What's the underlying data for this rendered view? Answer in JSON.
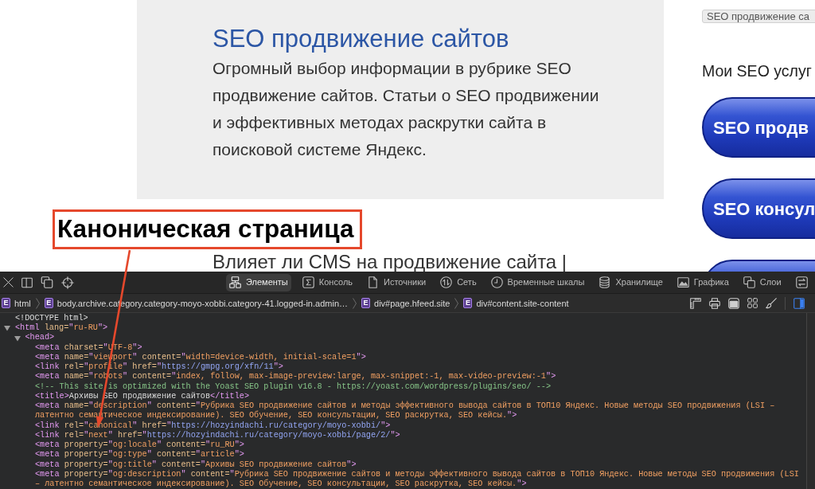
{
  "page": {
    "category": {
      "title": "SEO продвижение сайтов",
      "description_lines": [
        "Огромный выбор информации в рубрике SEO",
        "продвижение сайтов. Статьи о SEO продвижении",
        "и эффективных методах раскрутки сайта в",
        "поисковой системе Яндекс."
      ]
    },
    "annotation": {
      "label": "Каноническая страница"
    },
    "next_post_title": "Влияет ли CMS на продвижение сайта |",
    "sidebar": {
      "category_tag": "SEO продвижение са",
      "heading": "Мои SEO услуг",
      "service_buttons": [
        {
          "kind": "labeled",
          "label": "SEO продв"
        },
        {
          "kind": "labeled",
          "label": "SEO консул"
        },
        {
          "kind": "cut"
        }
      ]
    }
  },
  "devtools": {
    "tabs": [
      {
        "label": "Элементы",
        "selected": true
      },
      {
        "label": "Консоль",
        "selected": false
      },
      {
        "label": "Источники",
        "selected": false
      },
      {
        "label": "Сеть",
        "selected": false
      },
      {
        "label": "Временные шкалы",
        "selected": false
      },
      {
        "label": "Хранилище",
        "selected": false
      },
      {
        "label": "Графика",
        "selected": false
      },
      {
        "label": "Слои",
        "selected": false
      },
      {
        "selected": false
      }
    ],
    "sidebar_toggle": {
      "on": true
    },
    "breadcrumbs": [
      {
        "badge": "E",
        "label": "html"
      },
      {
        "badge": "E",
        "label": "body.archive.category.category-moyo-xobbi.category-41.logged-in.admin…"
      },
      {
        "badge": "E",
        "label": "div#page.hfeed.site"
      },
      {
        "badge": "E",
        "label": "div#content.site-content"
      }
    ],
    "dom_tree": [
      {
        "tokens": [
          {
            "kind": "text",
            "text": "<!DOCTYPE html>"
          }
        ]
      },
      {
        "expanded": true,
        "tokens": [
          {
            "kind": "tag",
            "text": "<html"
          },
          {
            "kind": "attr",
            "text": " lang="
          },
          {
            "kind": "value",
            "text": "\"ru-RU\""
          },
          {
            "kind": "tag",
            "text": ">"
          }
        ],
        "children": [
          {
            "expanded": true,
            "tokens": [
              {
                "kind": "tag",
                "text": "<head>"
              }
            ],
            "children": [
              {
                "tokens": [
                  {
                    "kind": "tag",
                    "text": "<meta"
                  },
                  {
                    "kind": "attr",
                    "text": " charset="
                  },
                  {
                    "kind": "value",
                    "text": "\"UTF-8\""
                  },
                  {
                    "kind": "tag",
                    "text": ">"
                  }
                ]
              },
              {
                "tokens": [
                  {
                    "kind": "tag",
                    "text": "<meta"
                  },
                  {
                    "kind": "attr",
                    "text": " name="
                  },
                  {
                    "kind": "value",
                    "text": "\"viewport\""
                  },
                  {
                    "kind": "attr",
                    "text": " content="
                  },
                  {
                    "kind": "value",
                    "text": "\"width=device-width, initial-scale=1\""
                  },
                  {
                    "kind": "tag",
                    "text": ">"
                  }
                ]
              },
              {
                "tokens": [
                  {
                    "kind": "tag",
                    "text": "<link"
                  },
                  {
                    "kind": "attr",
                    "text": " rel="
                  },
                  {
                    "kind": "value",
                    "text": "\"profile\""
                  },
                  {
                    "kind": "attr",
                    "text": " href="
                  },
                  {
                    "kind": "url",
                    "text": "\"https://gmpg.org/xfn/11\""
                  },
                  {
                    "kind": "tag",
                    "text": ">"
                  }
                ]
              },
              {
                "tokens": [
                  {
                    "kind": "tag",
                    "text": "<meta"
                  },
                  {
                    "kind": "attr",
                    "text": " name="
                  },
                  {
                    "kind": "value",
                    "text": "\"robots\""
                  },
                  {
                    "kind": "attr",
                    "text": " content="
                  },
                  {
                    "kind": "value",
                    "text": "\"index, follow, max-image-preview:large, max-snippet:-1, max-video-preview:-1\""
                  },
                  {
                    "kind": "tag",
                    "text": ">"
                  }
                ]
              },
              {
                "tokens": [
                  {
                    "kind": "comment",
                    "text": "<!-- This site is optimized with the Yoast SEO plugin v16.8 - https://yoast.com/wordpress/plugins/seo/ -->"
                  }
                ]
              },
              {
                "tokens": [
                  {
                    "kind": "tag",
                    "text": "<title>"
                  },
                  {
                    "kind": "text",
                    "text": "Архивы SEO продвижение сайтов"
                  },
                  {
                    "kind": "tag",
                    "text": "</title>"
                  }
                ]
              },
              {
                "tokens": [
                  {
                    "kind": "tag",
                    "text": "<meta"
                  },
                  {
                    "kind": "attr",
                    "text": " name="
                  },
                  {
                    "kind": "value",
                    "text": "\"description\""
                  },
                  {
                    "kind": "attr",
                    "text": " content="
                  },
                  {
                    "kind": "value",
                    "text": "\"Рубрика SEO продвижение сайтов и методы эффективного вывода сайтов в ТОП10 Яндекс. Новые методы SEO продвижения (LSI – латентно семантическое индексирование). SEO Обучение, SEO консультации, SEO раскрутка, SEO кейсы.\""
                  },
                  {
                    "kind": "tag",
                    "text": ">"
                  }
                ]
              },
              {
                "tokens": [
                  {
                    "kind": "tag",
                    "text": "<link"
                  },
                  {
                    "kind": "attr",
                    "text": " rel="
                  },
                  {
                    "kind": "value",
                    "text": "\"canonical\""
                  },
                  {
                    "kind": "attr",
                    "text": " href="
                  },
                  {
                    "kind": "url",
                    "text": "\"https://hozyindachi.ru/category/moyo-xobbi/\""
                  },
                  {
                    "kind": "tag",
                    "text": ">"
                  }
                ]
              },
              {
                "tokens": [
                  {
                    "kind": "tag",
                    "text": "<link"
                  },
                  {
                    "kind": "attr",
                    "text": " rel="
                  },
                  {
                    "kind": "value",
                    "text": "\"next\""
                  },
                  {
                    "kind": "attr",
                    "text": " href="
                  },
                  {
                    "kind": "url",
                    "text": "\"https://hozyindachi.ru/category/moyo-xobbi/page/2/\""
                  },
                  {
                    "kind": "tag",
                    "text": ">"
                  }
                ]
              },
              {
                "tokens": [
                  {
                    "kind": "tag",
                    "text": "<meta"
                  },
                  {
                    "kind": "attr",
                    "text": " property="
                  },
                  {
                    "kind": "value",
                    "text": "\"og:locale\""
                  },
                  {
                    "kind": "attr",
                    "text": " content="
                  },
                  {
                    "kind": "value",
                    "text": "\"ru_RU\""
                  },
                  {
                    "kind": "tag",
                    "text": ">"
                  }
                ]
              },
              {
                "tokens": [
                  {
                    "kind": "tag",
                    "text": "<meta"
                  },
                  {
                    "kind": "attr",
                    "text": " property="
                  },
                  {
                    "kind": "value",
                    "text": "\"og:type\""
                  },
                  {
                    "kind": "attr",
                    "text": " content="
                  },
                  {
                    "kind": "value",
                    "text": "\"article\""
                  },
                  {
                    "kind": "tag",
                    "text": ">"
                  }
                ]
              },
              {
                "tokens": [
                  {
                    "kind": "tag",
                    "text": "<meta"
                  },
                  {
                    "kind": "attr",
                    "text": " property="
                  },
                  {
                    "kind": "value",
                    "text": "\"og:title\""
                  },
                  {
                    "kind": "attr",
                    "text": " content="
                  },
                  {
                    "kind": "value",
                    "text": "\"Архивы SEO продвижение сайтов\""
                  },
                  {
                    "kind": "tag",
                    "text": ">"
                  }
                ]
              },
              {
                "tokens": [
                  {
                    "kind": "tag",
                    "text": "<meta"
                  },
                  {
                    "kind": "attr",
                    "text": " property="
                  },
                  {
                    "kind": "value",
                    "text": "\"og:description\""
                  },
                  {
                    "kind": "attr",
                    "text": " content="
                  },
                  {
                    "kind": "value",
                    "text": "\"Рубрика SEO продвижение сайтов и методы эффективного вывода сайтов в ТОП10 Яндекс. Новые методы SEO продвижения (LSI – латентно семантическое индексирование). SEO Обучение, SEO консультации, SEO раскрутка, SEO кейсы.\""
                  },
                  {
                    "kind": "tag",
                    "text": ">"
                  }
                ]
              }
            ]
          }
        ]
      }
    ]
  }
}
